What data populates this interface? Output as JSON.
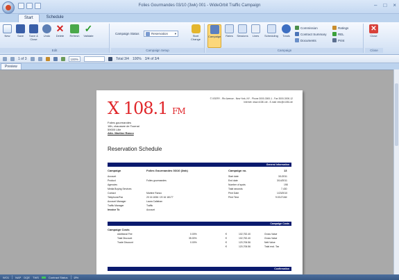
{
  "window": {
    "title": "Folies Gourmandes 03/10 (3wk) 001 - WideOrbit Traffic Campaign"
  },
  "tabs": [
    "Start",
    "Schedule"
  ],
  "ribbon": {
    "edit": {
      "label": "Edit",
      "buttons": [
        "New",
        "Save",
        "Save & Close",
        "Undo",
        "Delete",
        "Refresh",
        "Validate"
      ]
    },
    "campaign_setup": {
      "label": "Campaign Setup",
      "status_label": "Campaign Status",
      "status_value": "Reservation",
      "start_change": "Start Change"
    },
    "campaign": {
      "label": "Campaign",
      "buttons": [
        "Campaign",
        "Rates",
        "Sessions",
        "Lines",
        "Scheduling",
        "Totals"
      ],
      "small": [
        "Commission",
        "Contract Summary",
        "Documents",
        "Ratings",
        "REL",
        "Print"
      ]
    },
    "close": {
      "label": "Close",
      "button": "Close"
    }
  },
  "preview_toolbar": {
    "page": "1 of 3",
    "zoom": "100%",
    "total": "Total 3/4",
    "percent": "100%",
    "pages_of": "3/4 of 3/4"
  },
  "preview_tab": "Preview",
  "report": {
    "logo_main": "X 108.1",
    "logo_suffix": "FM",
    "address": "© XSERY - Rtx Avenue - New York, NY - Phone 3000-3000-1 - Fax 3000-3000-12",
    "website": "Internet: www.x1081.de - E-mail: info@x1081.de",
    "recipient": [
      "Folies gourmandes",
      "18h, chaussee de Tournai",
      "59000 Lille"
    ],
    "attention": "Attn. Martine Ranco",
    "doc_title": "Reservation Schedule",
    "section_general": "General Information",
    "campaign_label": "Campaign",
    "campaign_value": "Folies Gourmandes 03/10 (3wk)",
    "campaign_no_label": "Campaign no.",
    "campaign_no_value": "13",
    "left_fields": [
      {
        "k": "Account",
        "v": ""
      },
      {
        "k": "Product",
        "v": "Folies gourmandes"
      },
      {
        "k": "Agencies",
        "v": ""
      },
      {
        "k": "Media Buying Services",
        "v": ""
      },
      {
        "k": "Contact",
        "v": "Martine Ranco"
      },
      {
        "k": "Telephone/Fax",
        "v": "20 16 1836 / 20 16 18177"
      },
      {
        "k": "Account Manager",
        "v": "Laura Callahan"
      },
      {
        "k": "Traffic Manager",
        "v": "Traffic"
      },
      {
        "k": "Invoice To",
        "v": "Account"
      }
    ],
    "right_fields": [
      {
        "k": "Start date",
        "v": "3/1/2011"
      },
      {
        "k": "End date",
        "v": "3/14/2011"
      },
      {
        "k": "Number of spots",
        "v": "198"
      },
      {
        "k": "Total seconds",
        "v": "7,430"
      },
      {
        "k": "Print Date",
        "v": "1/23/2010"
      },
      {
        "k": "Print Time",
        "v": "9:03:27AM"
      }
    ],
    "section_costs": "Campaign Costs",
    "costs_title": "Campaign Costs",
    "costs": [
      {
        "k": "Additional Fee",
        "pct": "0.00%",
        "cur": "€",
        "amt": "102,752.40",
        "label": "Gross Value"
      },
      {
        "k": "Total Discount",
        "pct": "35.00%",
        "cur": "€",
        "amt": "102,752.40",
        "label": "Gross Value"
      },
      {
        "k": "Trade Discount",
        "pct": "0.00%",
        "cur": "€",
        "amt": "120,706.56",
        "label": "Nett Value"
      },
      {
        "k": "",
        "pct": "",
        "cur": "€",
        "amt": "120,706.56",
        "label": "Total excl. Tax"
      }
    ],
    "section_confirmation": "Confirmation"
  },
  "statusbar": {
    "items": [
      "WO1",
      "NAP",
      "DQE",
      "TWS",
      "Contract Status",
      "Ø%"
    ]
  }
}
